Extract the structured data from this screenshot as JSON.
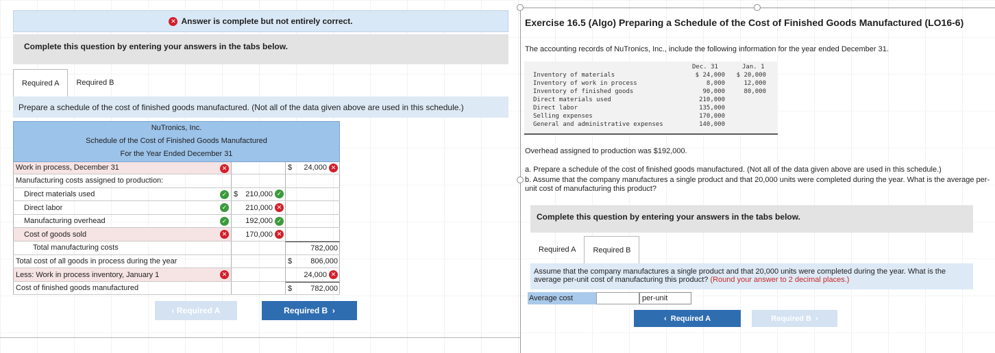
{
  "left": {
    "banner": "Answer is complete but not entirely correct.",
    "complete_box": "Complete this question by entering your answers in the tabs below.",
    "tabs": [
      "Required A",
      "Required B"
    ],
    "prompt": "Prepare a schedule of the cost of finished goods manufactured. (Not all of the data given above are used in this schedule.)",
    "schedule": {
      "company": "NuTronics, Inc.",
      "title": "Schedule of the Cost of Finished Goods Manufactured",
      "period": "For the Year Ended December 31",
      "rows": [
        {
          "label": "Work in process, December 31",
          "label_status": "incorrect",
          "amt1": "",
          "amt2": "24,000",
          "amt2_dollar": true,
          "amt2_status": "incorrect"
        },
        {
          "label": "Manufacturing costs assigned to production:",
          "amt1": "",
          "amt2": ""
        },
        {
          "label": "Direct materials used",
          "label_status": "correct",
          "amt1": "210,000",
          "amt1_dollar": true,
          "amt1_status": "correct",
          "amt2": ""
        },
        {
          "label": "Direct labor",
          "label_status": "correct",
          "amt1": "210,000",
          "amt1_status": "incorrect",
          "amt2": ""
        },
        {
          "label": "Manufacturing overhead",
          "label_status": "correct",
          "amt1": "192,000",
          "amt1_status": "correct",
          "amt2": ""
        },
        {
          "label": "Cost of goods sold",
          "label_status": "incorrect",
          "amt1": "170,000",
          "amt1_status": "incorrect",
          "amt2": ""
        },
        {
          "label": "Total manufacturing costs",
          "amt1": "",
          "amt2": "782,000"
        },
        {
          "label": "Total cost of all goods in process during the year",
          "amt1": "",
          "amt2": "806,000",
          "amt2_dollar": true
        },
        {
          "label": "Less: Work in process inventory, January 1",
          "label_status": "incorrect",
          "amt1": "",
          "amt2": "24,000",
          "amt2_status": "incorrect"
        },
        {
          "label": "Cost of finished goods manufactured",
          "amt1": "",
          "amt2": "782,000",
          "amt2_dollar": true
        }
      ]
    },
    "btn_prev": "Required A",
    "btn_next": "Required B"
  },
  "right": {
    "title": "Exercise 16.5 (Algo) Preparing a Schedule of the Cost of Finished Goods Manufactured (LO16-6)",
    "intro": "The accounting records of NuTronics, Inc., include the following information for the year ended December 31.",
    "records": {
      "col1": "Dec. 31",
      "col2": "Jan. 1",
      "rows": [
        {
          "label": "Inventory of materials",
          "v1": "$ 24,000",
          "v2": "$ 20,000"
        },
        {
          "label": "Inventory of work in process",
          "v1": "8,000",
          "v2": "12,000"
        },
        {
          "label": "Inventory of finished goods",
          "v1": "90,000",
          "v2": "80,000"
        },
        {
          "label": "Direct materials used",
          "v1": "210,000",
          "v2": ""
        },
        {
          "label": "Direct labor",
          "v1": "135,000",
          "v2": ""
        },
        {
          "label": "Selling expenses",
          "v1": "170,000",
          "v2": ""
        },
        {
          "label": "General and administrative expenses",
          "v1": "140,000",
          "v2": ""
        }
      ]
    },
    "overhead": "Overhead assigned to production was $192,000.",
    "part_a": "a. Prepare a schedule of the cost of finished goods manufactured. (Not all of the data given above are used in this schedule.)",
    "part_b": "b. Assume that the company manufactures a single product and that 20,000 units were completed during the year. What is the average per-unit cost of manufacturing this product?",
    "complete_box": "Complete this question by entering your answers in the tabs below.",
    "tabs": [
      "Required A",
      "Required B"
    ],
    "prompt": "Assume that the company manufactures a single product and that 20,000 units were completed during the year. What is the average per-unit cost of manufacturing this product?",
    "prompt_note": "(Round your answer to 2 decimal places.)",
    "avg_label": "Average cost",
    "avg_value": "",
    "avg_unit": "per-unit",
    "btn_prev": "Required A",
    "btn_next": "Required B"
  }
}
